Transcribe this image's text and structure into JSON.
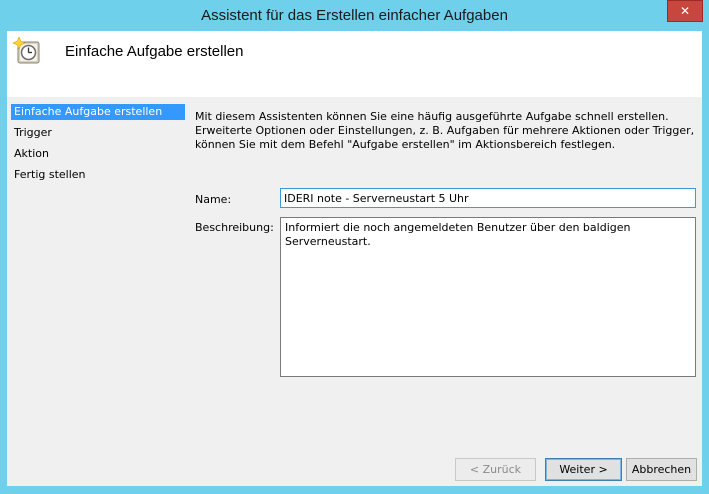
{
  "window": {
    "title": "Assistent für das Erstellen einfacher Aufgaben",
    "close_glyph": "✕"
  },
  "header": {
    "title": "Einfache Aufgabe erstellen",
    "icon": "task-clock-icon"
  },
  "nav": {
    "items": [
      {
        "label": "Einfache Aufgabe erstellen",
        "selected": true
      },
      {
        "label": "Trigger",
        "selected": false
      },
      {
        "label": "Aktion",
        "selected": false
      },
      {
        "label": "Fertig stellen",
        "selected": false
      }
    ]
  },
  "intro": {
    "line1": "Mit diesem Assistenten können Sie eine häufig ausgeführte Aufgabe schnell erstellen.",
    "line2": "Erweiterte Optionen oder Einstellungen, z. B. Aufgaben für mehrere Aktionen oder Trigger,",
    "line3": "können Sie mit dem Befehl \"Aufgabe erstellen\" im Aktionsbereich festlegen."
  },
  "form": {
    "name_label": "Name:",
    "name_value": "IDERI note - Serverneustart 5 Uhr",
    "description_label": "Beschreibung:",
    "description_value": "Informiert die noch angemeldeten Benutzer über den baldigen Serverneustart."
  },
  "buttons": {
    "back": "< Zurück",
    "next": "Weiter >",
    "cancel": "Abbrechen"
  },
  "colors": {
    "frame": "#6fd0ec",
    "selection": "#3399ff",
    "close": "#c7463d"
  }
}
